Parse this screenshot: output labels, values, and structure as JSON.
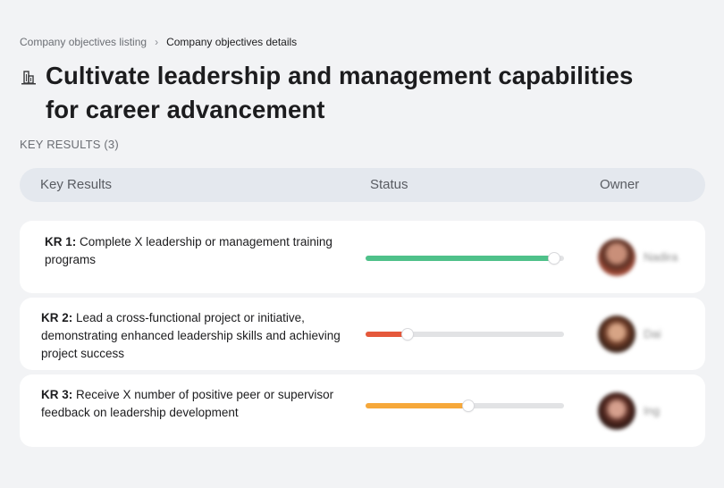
{
  "breadcrumb": {
    "parent": "Company objectives listing",
    "separator": "›",
    "current": "Company objectives details"
  },
  "objective": {
    "icon": "building-icon",
    "title": "Cultivate leadership and management capabilities for career advancement"
  },
  "key_results_label": "KEY RESULTS (3)",
  "table": {
    "headers": {
      "key_results": "Key Results",
      "status": "Status",
      "owner": "Owner"
    }
  },
  "key_results": [
    {
      "id": "KR 1:",
      "text": " Complete X leadership or management training programs",
      "progress": 0.95,
      "color": "#4fc18a",
      "owner": "Nadira"
    },
    {
      "id": "KR 2:",
      "text": " Lead a cross-functional project or initiative, demonstrating enhanced leadership skills and achieving project success",
      "progress": 0.21,
      "color": "#e5583b",
      "owner": "Dai"
    },
    {
      "id": "KR 3:",
      "text": " Receive X number of positive peer or supervisor feedback on leadership development",
      "progress": 0.52,
      "color": "#f6a83a",
      "owner": "Ing"
    }
  ]
}
